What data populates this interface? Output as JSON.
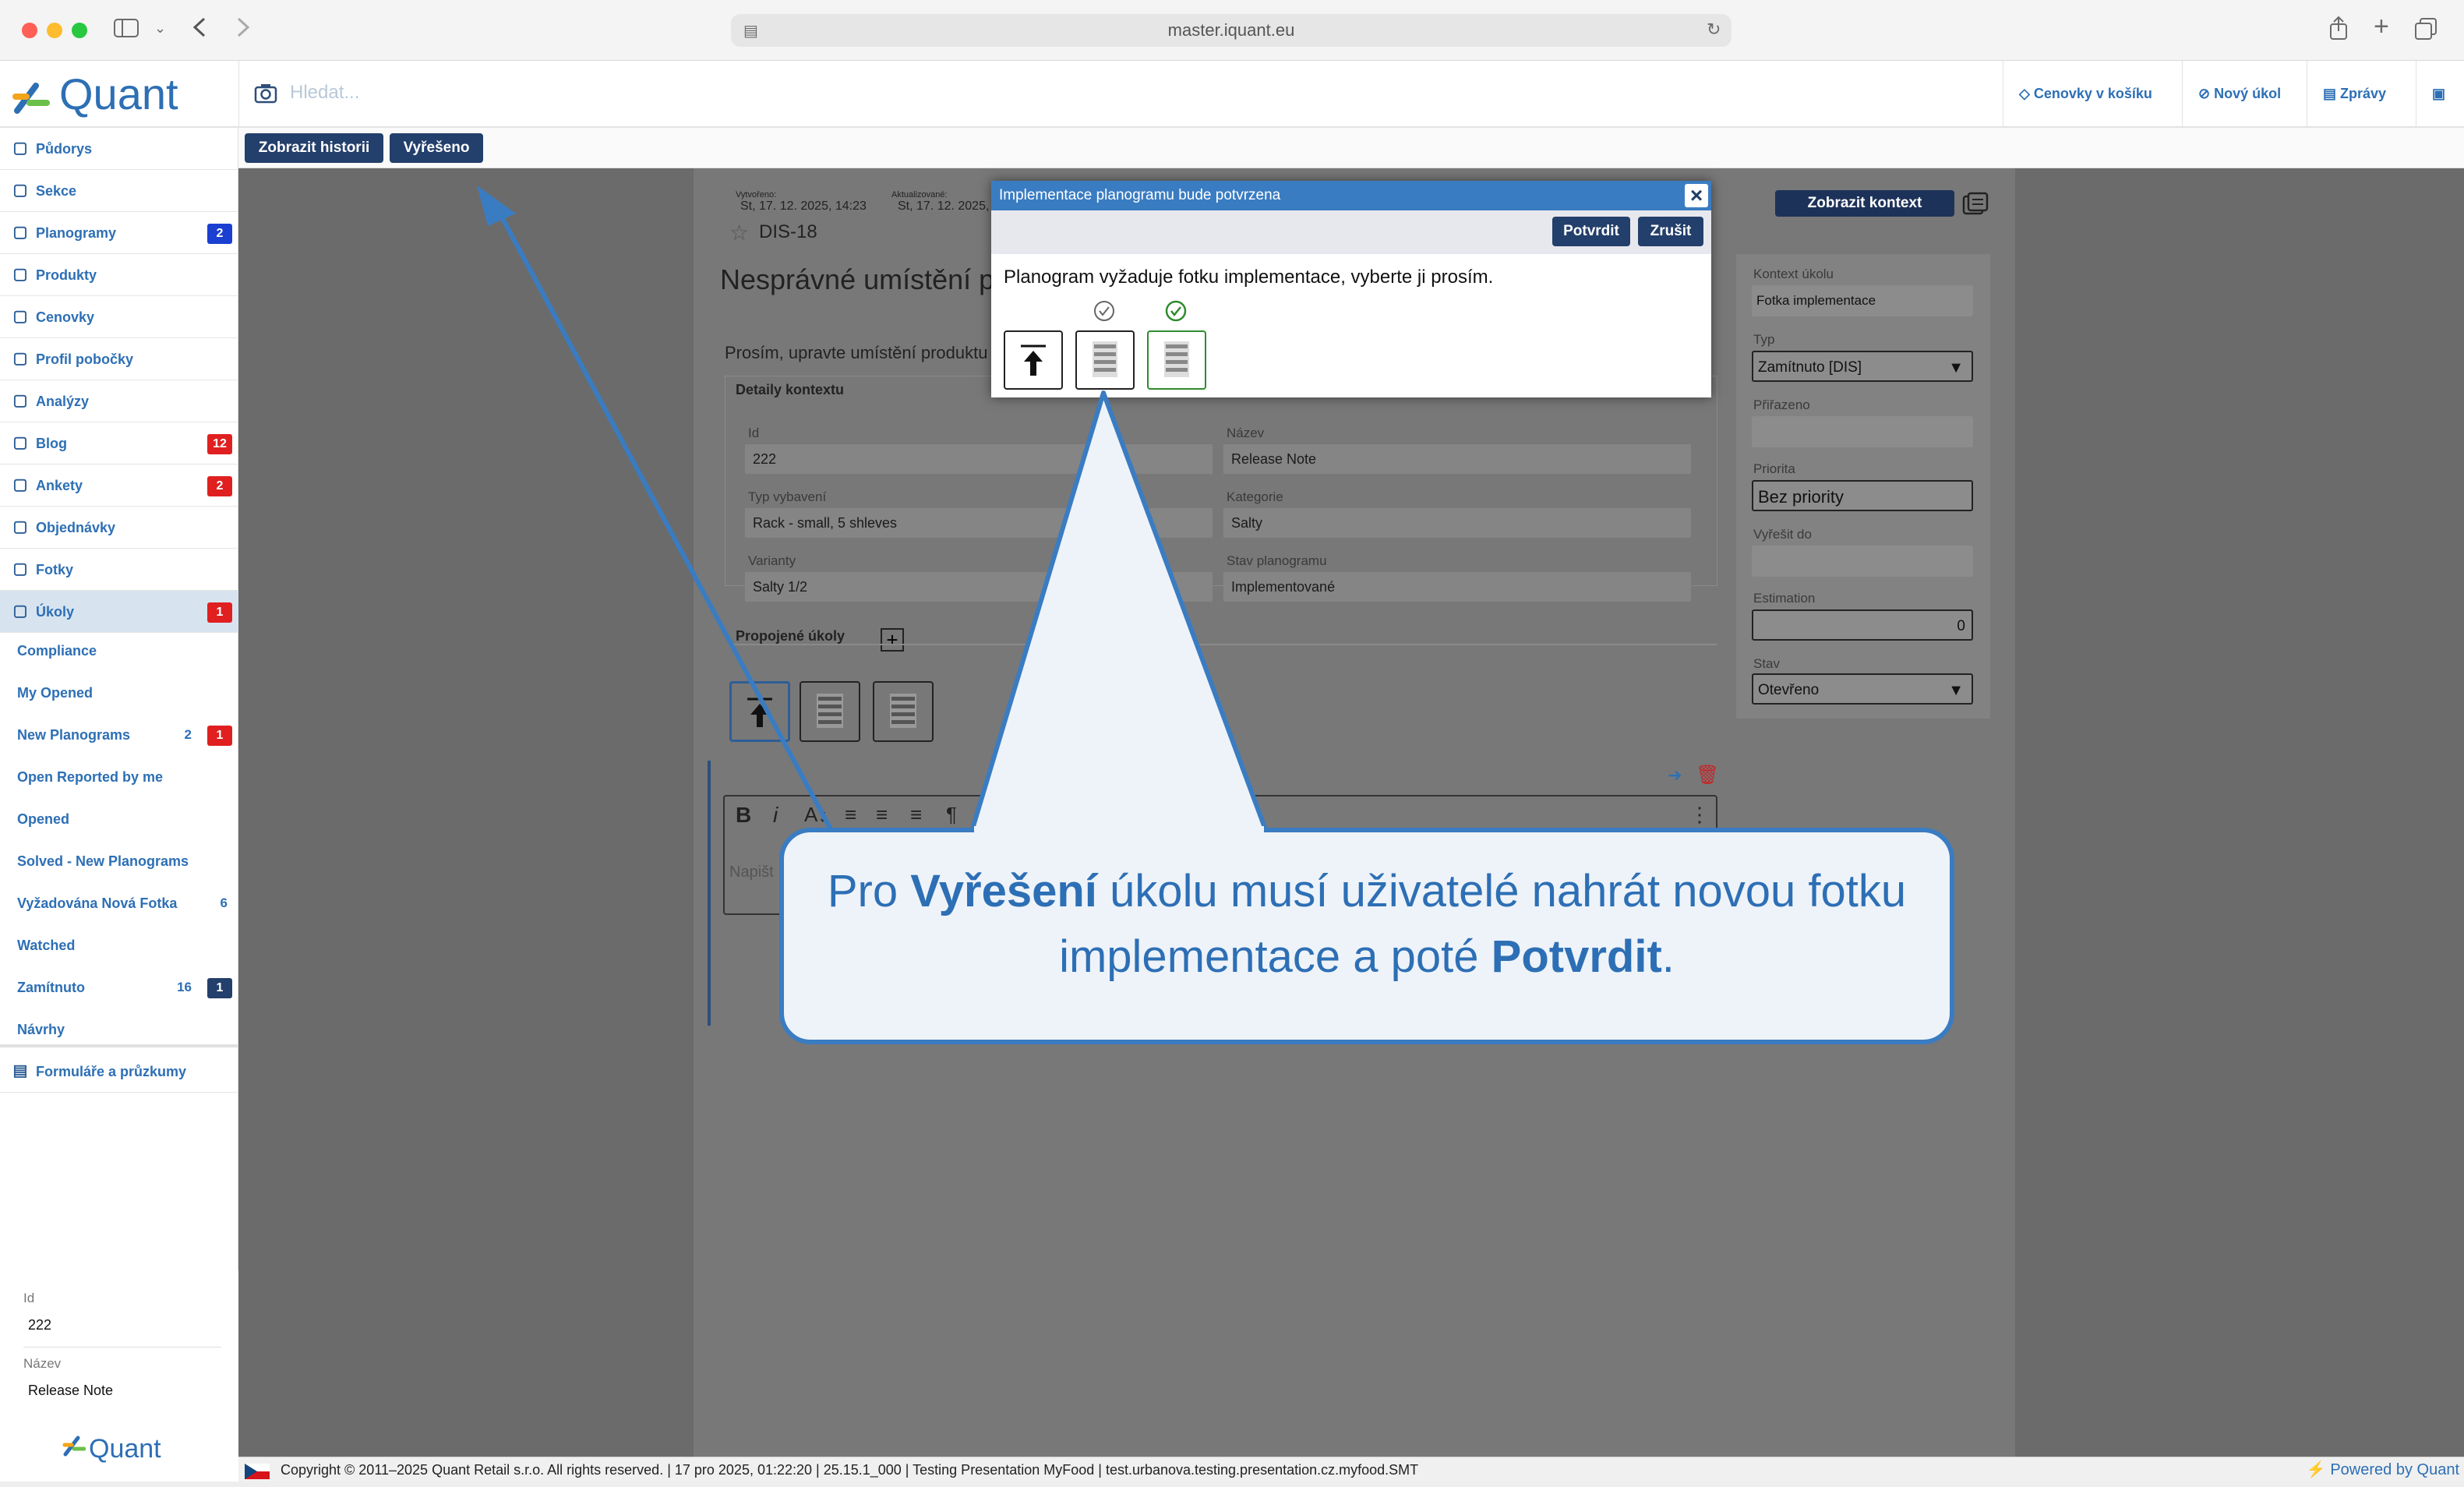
{
  "browser": {
    "url": "master.iquant.eu"
  },
  "header": {
    "logo": "Quant",
    "search_placeholder": "Hledat...",
    "buttons": [
      "Cenovky v košíku",
      "Nový úkol",
      "Zprávy"
    ]
  },
  "actionbar": {
    "history_label": "Zobrazit historii",
    "resolved_label": "Vyřešeno"
  },
  "sidebar": {
    "items": [
      {
        "label": "Půdorys",
        "icon": "floorplan-icon"
      },
      {
        "label": "Sekce",
        "icon": "section-icon"
      },
      {
        "label": "Planogramy",
        "icon": "planogram-icon",
        "badge": "2",
        "badge_color": "#1a3fd1"
      },
      {
        "label": "Produkty",
        "icon": "product-icon"
      },
      {
        "label": "Cenovky",
        "icon": "tag-icon"
      },
      {
        "label": "Profil pobočky",
        "icon": "info-icon"
      },
      {
        "label": "Analýzy",
        "icon": "chart-icon"
      },
      {
        "label": "Blog",
        "icon": "edit-icon",
        "badge": "12",
        "badge_color": "#e02020"
      },
      {
        "label": "Ankety",
        "icon": "survey-icon",
        "badge": "2",
        "badge_color": "#e02020"
      },
      {
        "label": "Objednávky",
        "icon": "order-icon"
      },
      {
        "label": "Fotky",
        "icon": "photo-icon"
      },
      {
        "label": "Úkoly",
        "icon": "check-circle-icon",
        "badge": "1",
        "badge_color": "#e02020"
      }
    ],
    "subitems": [
      {
        "label": "Compliance"
      },
      {
        "label": "My Opened"
      },
      {
        "label": "New Planograms",
        "count": "2",
        "badge": "1",
        "badge_color": "#e02020"
      },
      {
        "label": "Open Reported by me"
      },
      {
        "label": "Opened"
      },
      {
        "label": "Solved - New Planograms"
      },
      {
        "label": "Vyžadována Nová Fotka",
        "count": "6"
      },
      {
        "label": "Watched"
      },
      {
        "label": "Zamítnuto",
        "count": "16",
        "badge": "1",
        "badge_color": "#233f6b"
      },
      {
        "label": "Návrhy"
      }
    ],
    "forms_label": "Formuláře a průzkumy",
    "bottom": {
      "id_label": "Id",
      "id_value": "222",
      "name_label": "Název",
      "name_value": "Release Note",
      "logo": "Quant"
    }
  },
  "task": {
    "created_label": "Vytvořeno:",
    "created_value": "St, 17. 12. 2025, 14:23",
    "updated_label": "Aktualizované:",
    "updated_value": "St, 17. 12. 2025,",
    "code": "DIS-18",
    "title": "Nesprávné umístění p",
    "description": "Prosím, upravte umístění produktu p",
    "context_title": "Detaily kontextu",
    "fields": {
      "id_label": "Id",
      "id_value": "222",
      "name_label": "Název",
      "name_value": "Release Note",
      "equip_label": "Typ vybavení",
      "equip_value": "Rack - small, 5 shleves",
      "category_label": "Kategorie",
      "category_value": "Salty",
      "variant_label": "Varianty",
      "variant_value": "Salty 1/2",
      "state_label": "Stav planogramu",
      "state_value": "Implementované"
    },
    "linked_label": "Propojené úkoly",
    "editor_placeholder": "Napišt"
  },
  "right_panel": {
    "show_context": "Zobrazit kontext",
    "context_label": "Kontext úkolu",
    "context_value": "Fotka implementace",
    "type_label": "Typ",
    "type_value": "Zamítnuto [DIS]",
    "assigned_label": "Přiřazeno",
    "priority_label": "Priorita",
    "priority_value": "Bez priority",
    "due_label": "Vyřešit do",
    "estimation_label": "Estimation",
    "estimation_value": "0",
    "status_label": "Stav",
    "status_value": "Otevřeno"
  },
  "dialog": {
    "title": "Implementace planogramu bude potvrzena",
    "confirm": "Potvrdit",
    "cancel": "Zrušit",
    "message": "Planogram vyžaduje fotku implementace, vyberte ji prosím."
  },
  "callout": {
    "t1": "Pro ",
    "b1": "Vyřešení",
    "t2": " úkolu musí uživatelé nahrát novou fotku implementace a poté ",
    "b2": "Potvrdit",
    "t3": "."
  },
  "footer": {
    "text": "Copyright © 2011–2025 Quant Retail s.r.o. All rights reserved. | 17 pro 2025, 01:22:20 | 25.15.1_000 | Testing Presentation MyFood | test.urbanova.testing.presentation.cz.myfood.SMT",
    "powered": "Powered by Quant"
  }
}
